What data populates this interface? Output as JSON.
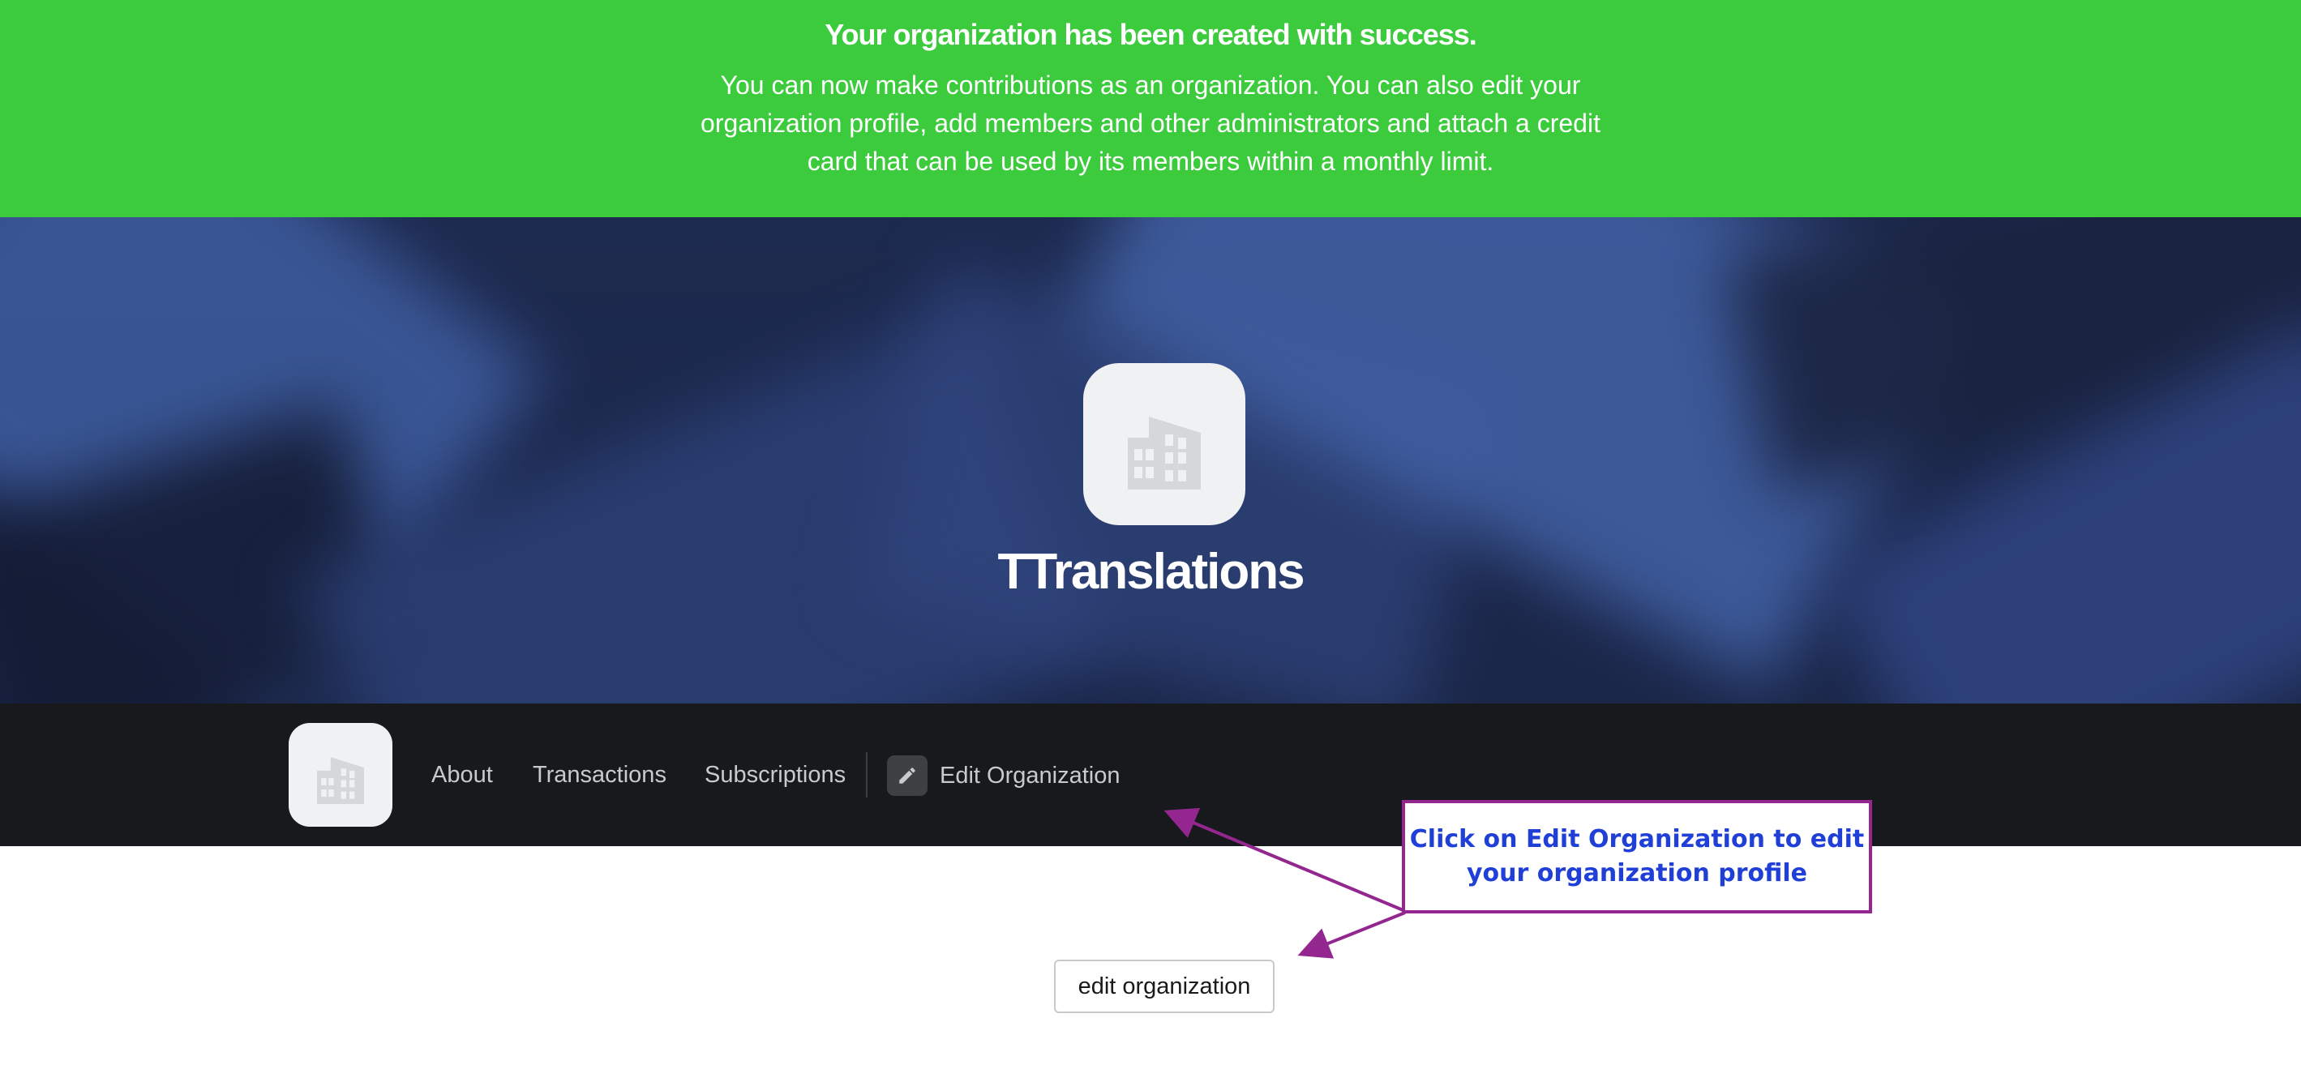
{
  "banner": {
    "title": "Your organization has been created with success.",
    "body": "You can now make contributions as an organization. You can also edit your organization profile, add members and other administrators and attach a credit card that can be used by its members within a monthly limit.",
    "background_color": "#3ccb3c"
  },
  "profile": {
    "name": "TTranslations",
    "avatar_icon": "building-icon"
  },
  "nav": {
    "items": [
      {
        "label": "About"
      },
      {
        "label": "Transactions"
      },
      {
        "label": "Subscriptions"
      }
    ],
    "edit_label": "Edit Organization",
    "edit_icon": "pencil-icon",
    "background_color": "#18191c"
  },
  "annotation": {
    "text": "Click on Edit Organization to edit your organization profile",
    "border_color": "#93278f",
    "text_color": "#1f3fd6"
  },
  "edit_button": {
    "label": "edit organization"
  }
}
